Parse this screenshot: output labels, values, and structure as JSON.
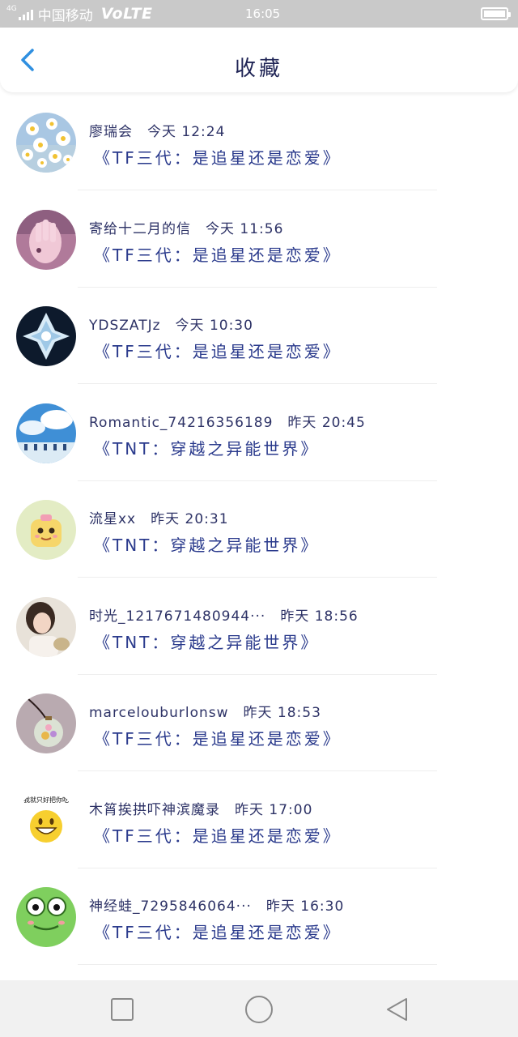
{
  "status_bar": {
    "network": "4G",
    "carrier": "中国移动",
    "volte": "VoLTE",
    "time": "16:05"
  },
  "header": {
    "title": "收藏",
    "back_icon": "chevron-left-icon",
    "accent_color": "#2f8fe0"
  },
  "items": [
    {
      "author": "廖瑞会",
      "time": "今天 12:24",
      "title": "《TF三代：是追星还是恋爱》",
      "avatar": "daisy-flowers"
    },
    {
      "author": "寄给十二月的信",
      "time": "今天 11:56",
      "title": "《TF三代：是追星还是恋爱》",
      "avatar": "pink-hand"
    },
    {
      "author": "YDSZATJz",
      "time": "今天 10:30",
      "title": "《TF三代：是追星还是恋爱》",
      "avatar": "ice-crystal"
    },
    {
      "author": "Romantic_7421635618​9",
      "time": "昨天 20:45",
      "title": "《TNT：穿越之异能世界》",
      "avatar": "blue-sky-clouds"
    },
    {
      "author": "流星xx",
      "time": "昨天 20:31",
      "title": "《TNT：穿越之异能世界》",
      "avatar": "cartoon-yellow-character"
    },
    {
      "author": "时光_1217671480944···",
      "time": "昨天 18:56",
      "title": "《TNT：穿越之异能世界》",
      "avatar": "girl-portrait"
    },
    {
      "author": "marcelouburlonsw",
      "time": "昨天 18:53",
      "title": "《TF三代：是追星还是恋爱》",
      "avatar": "glass-bottle-pendant"
    },
    {
      "author": "木筲挨拱吓神滨魔录",
      "time": "昨天 17:00",
      "title": "《TF三代：是追星还是恋爱》",
      "avatar": "smiley-emoji",
      "avatar_text": "我就只好把你吃"
    },
    {
      "author": "神经蛙_7295846064···",
      "time": "昨天 16:30",
      "title": "《TF三代：是追星还是恋爱》",
      "avatar": "green-frog"
    }
  ],
  "nav_bar": {
    "recent_icon": "square-icon",
    "home_icon": "circle-icon",
    "back_icon": "triangle-back-icon"
  }
}
